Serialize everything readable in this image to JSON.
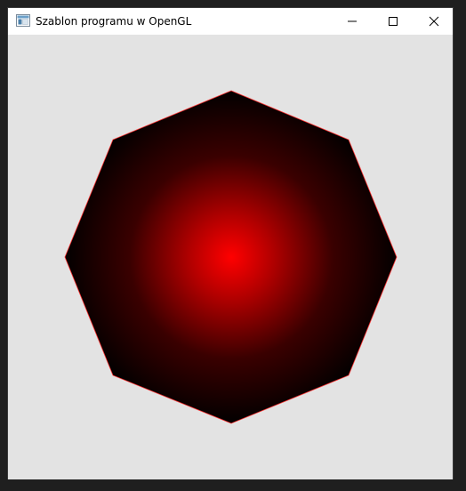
{
  "window": {
    "title": "Szablon programu w OpenGL",
    "icon": "app-window-icon",
    "controls": [
      "minimize-icon",
      "maximize-icon",
      "close-icon"
    ]
  },
  "scene": {
    "shape": "octagon",
    "center_color": "#ff0000",
    "edge_color": "#000000",
    "outline_color": "#ff3333",
    "background_color": "#e3e3e3"
  }
}
